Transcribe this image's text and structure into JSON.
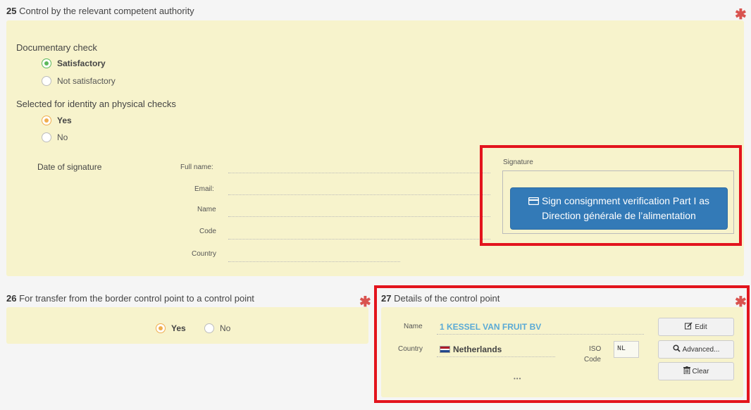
{
  "section25": {
    "number": "25",
    "title": "Control by the relevant competent authority",
    "documentary_check_label": "Documentary check",
    "doc_options": [
      "Satisfactory",
      "Not satisfactory"
    ],
    "identity_label": "Selected for identity an physical checks",
    "identity_options": [
      "Yes",
      "No"
    ],
    "date_of_signature_label": "Date of signature",
    "fields": {
      "full_name": "Full name:",
      "email": "Email:",
      "name": "Name",
      "code": "Code",
      "country": "Country"
    },
    "signature_label": "Signature",
    "sign_button": "Sign consignment verification Part I as Direction générale de l’alimentation"
  },
  "section26": {
    "number": "26",
    "title": "For transfer from the border control point to a control point",
    "options": [
      "Yes",
      "No"
    ]
  },
  "section27": {
    "number": "27",
    "title": "Details of the control point",
    "name_label": "Name",
    "name_value": "1 KESSEL VAN FRUIT BV",
    "country_label": "Country",
    "country_value": "Netherlands",
    "iso_label_1": "ISO",
    "iso_label_2": "Code",
    "iso_value": "NL",
    "more": "•••",
    "buttons": {
      "edit": "Edit",
      "advanced": "Advanced...",
      "clear": "Clear"
    }
  },
  "colors": {
    "panel": "#f7f3cc",
    "accent_blue": "#337ab7",
    "required_red": "#d9534f",
    "highlight_red": "#e3141d",
    "radio_green": "#5cb85c",
    "radio_orange": "#f0ad4e",
    "link_blue": "#5aaad6"
  }
}
